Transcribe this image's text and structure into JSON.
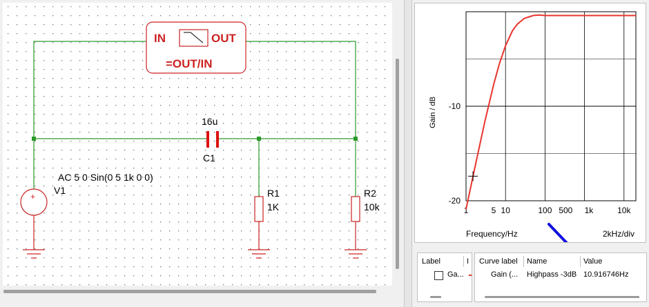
{
  "schematic": {
    "block": {
      "in_label": "IN",
      "out_label": "OUT",
      "formula": "=OUT/IN"
    },
    "capacitor": {
      "value": "16u",
      "name": "C1"
    },
    "source": {
      "spec": "AC 5 0 Sin(0 5 1k 0 0)",
      "name": "V1",
      "plus_sign": "+"
    },
    "resistor1": {
      "name": "R1",
      "value": "1K"
    },
    "resistor2": {
      "name": "R2",
      "value": "10k"
    }
  },
  "plot": {
    "y_axis_label": "Gain / dB",
    "y_ticks": [
      "-10",
      "-20"
    ],
    "x_ticks": [
      "1",
      "5",
      "10",
      "100",
      "500",
      "1k",
      "10k"
    ],
    "x_axis_label": "Frequency/Hz",
    "x_div_label": "2kHz/div",
    "curve_color": "#e8332d",
    "annotation_arrow_color": "#1010e0"
  },
  "chart_data": {
    "type": "line",
    "title": "",
    "xlabel": "Frequency/Hz",
    "ylabel": "Gain / dB",
    "x_scale": "log",
    "xlim": [
      1,
      20000
    ],
    "ylim": [
      -20,
      0
    ],
    "grid": true,
    "series": [
      {
        "x": [
          1,
          1.5,
          2,
          3,
          5,
          7,
          10,
          15,
          20,
          30,
          50,
          70,
          100,
          200,
          500,
          1000,
          10000,
          20000
        ],
        "values": [
          -20.9,
          -17.4,
          -15.0,
          -11.6,
          -7.7,
          -5.5,
          -3.6,
          -2.0,
          -1.3,
          -0.7,
          -0.4,
          -0.35,
          -0.4,
          -0.4,
          -0.4,
          -0.4,
          -0.4,
          -0.4
        ]
      }
    ],
    "marker": {
      "x": 1.5,
      "y": -17.4
    }
  },
  "label_panel": {
    "header": "Label",
    "header2": "I",
    "row_label": "Ga..."
  },
  "table": {
    "columns": [
      "Curve label",
      "Name",
      "Value"
    ],
    "rows": [
      [
        "Gain (...",
        "Highpass -3dB",
        "10.916746Hz"
      ]
    ]
  }
}
